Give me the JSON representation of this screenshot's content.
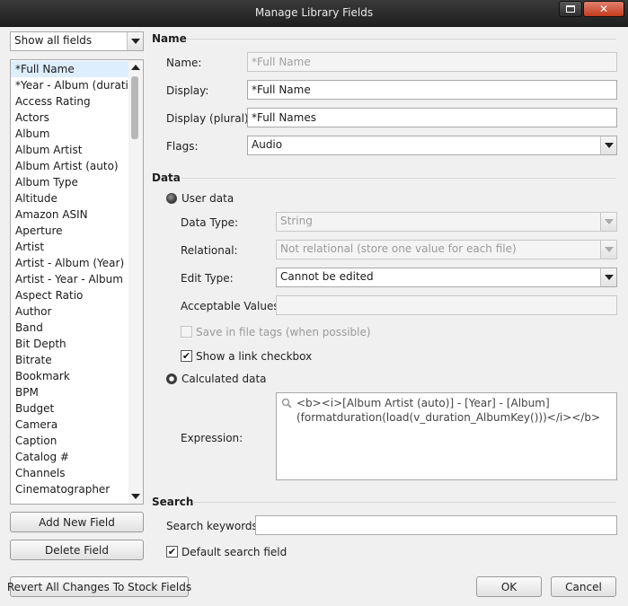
{
  "window": {
    "title": "Manage Library Fields"
  },
  "filter": {
    "value": "Show all fields"
  },
  "field_list": {
    "items": [
      "*Full Name",
      "*Year - Album (durati...",
      "Access Rating",
      "Actors",
      "Album",
      "Album Artist",
      "Album Artist (auto)",
      "Album Type",
      "Altitude",
      "Amazon ASIN",
      "Aperture",
      "Artist",
      "Artist - Album (Year)",
      "Artist - Year - Album",
      "Aspect Ratio",
      "Author",
      "Band",
      "Bit Depth",
      "Bitrate",
      "Bookmark",
      "BPM",
      "Budget",
      "Camera",
      "Caption",
      "Catalog #",
      "Channels",
      "Cinematographer"
    ],
    "selected_index": 0
  },
  "buttons": {
    "add_field": "Add New Field",
    "delete_field": "Delete Field",
    "revert_all": "Revert All Changes To Stock Fields",
    "ok": "OK",
    "cancel": "Cancel"
  },
  "name_section": {
    "header": "Name",
    "name_label": "Name:",
    "name_value": "*Full Name",
    "display_label": "Display:",
    "display_value": "*Full Name",
    "display_plural_label": "Display (plural):",
    "display_plural_value": "*Full Names",
    "flags_label": "Flags:",
    "flags_value": "Audio"
  },
  "data_section": {
    "header": "Data",
    "user_data_label": "User data",
    "data_type_label": "Data Type:",
    "data_type_value": "String",
    "relational_label": "Relational:",
    "relational_value": "Not relational (store one value for each file)",
    "edit_type_label": "Edit Type:",
    "edit_type_value": "Cannot be edited",
    "acceptable_values_label": "Acceptable Values:",
    "acceptable_values_value": "",
    "save_in_tags_label": "Save in file tags (when possible)",
    "show_link_label": "Show a link checkbox",
    "calculated_data_label": "Calculated data",
    "expression_label": "Expression:",
    "expression_line1": "<b><i>[Album Artist (auto)] - [Year] - [Album]",
    "expression_line2": "(formatduration(load(v_duration_AlbumKey()))</i></b>"
  },
  "search_section": {
    "header": "Search",
    "keywords_label": "Search keywords:",
    "keywords_value": "",
    "default_search_label": "Default search field"
  }
}
